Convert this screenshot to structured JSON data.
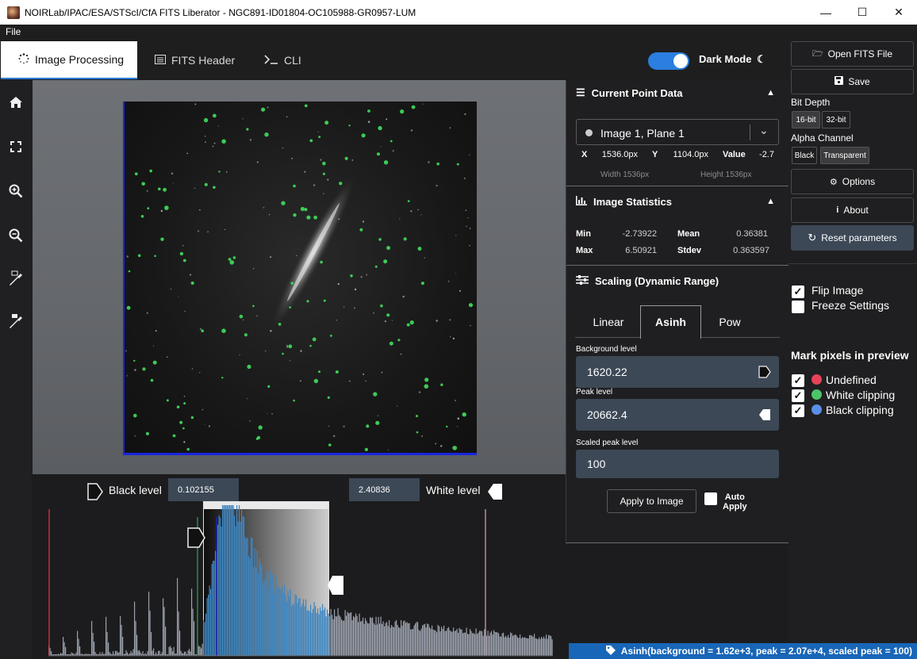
{
  "window": {
    "title": "NOIRLab/IPAC/ESA/STScI/CfA FITS Liberator - NGC891-ID01804-OC105988-GR0957-LUM",
    "minimize": "—",
    "maximize": "☐",
    "close": "✕"
  },
  "menu": {
    "file": "File"
  },
  "tabs": [
    {
      "label": "Image Processing",
      "icon": "spinner-icon"
    },
    {
      "label": "FITS Header",
      "icon": "list-icon"
    },
    {
      "label": "CLI",
      "icon": "terminal-icon"
    }
  ],
  "dark_mode": {
    "label": "Dark Mode",
    "on": true
  },
  "histogram": {
    "black_label": "Black level",
    "black_value": "0.102155",
    "white_value": "2.40836",
    "white_label": "White level"
  },
  "current_point": {
    "title": "Current Point Data",
    "plane": "Image 1, Plane 1",
    "x_label": "X",
    "x_value": "1536.0px",
    "y_label": "Y",
    "y_value": "1104.0px",
    "value_label": "Value",
    "value": "-2.7",
    "width": "Width 1536px",
    "height": "Height 1536px"
  },
  "statistics": {
    "title": "Image Statistics",
    "min_label": "Min",
    "min": "-2.73922",
    "max_label": "Max",
    "max": "6.50921",
    "mean_label": "Mean",
    "mean": "0.36381",
    "stdev_label": "Stdev",
    "stdev": "0.363597"
  },
  "scaling": {
    "title": "Scaling (Dynamic Range)",
    "tabs": [
      "Linear",
      "Asinh",
      "Pow"
    ],
    "active_tab": "Asinh",
    "background_label": "Background level",
    "background": "1620.22",
    "peak_label": "Peak level",
    "peak": "20662.4",
    "scaled_peak_label": "Scaled peak level",
    "scaled_peak": "100",
    "apply_label": "Apply to Image",
    "auto_apply_line1": "Auto",
    "auto_apply_line2": "Apply"
  },
  "sidebar": {
    "open": "Open FITS File",
    "save": "Save",
    "bit_depth_label": "Bit Depth",
    "bit16": "16-bit",
    "bit32": "32-bit",
    "alpha_label": "Alpha Channel",
    "black": "Black",
    "transparent": "Transparent",
    "options": "Options",
    "about": "About",
    "reset": "Reset parameters",
    "flip": "Flip Image",
    "freeze": "Freeze Settings",
    "mark_title": "Mark pixels in preview",
    "undefined": "Undefined",
    "white_clip": "White clipping",
    "black_clip": "Black clipping"
  },
  "status": "Asinh(background = 1.62e+3, peak = 2.07e+4, scaled peak = 100)",
  "colors": {
    "accent": "#2b7fe0",
    "field": "#3c4856",
    "undefined": "#e8425a",
    "white_clip": "#4cc46a",
    "black_clip": "#5b8ee6",
    "hist_selected": "#3f86c0"
  }
}
